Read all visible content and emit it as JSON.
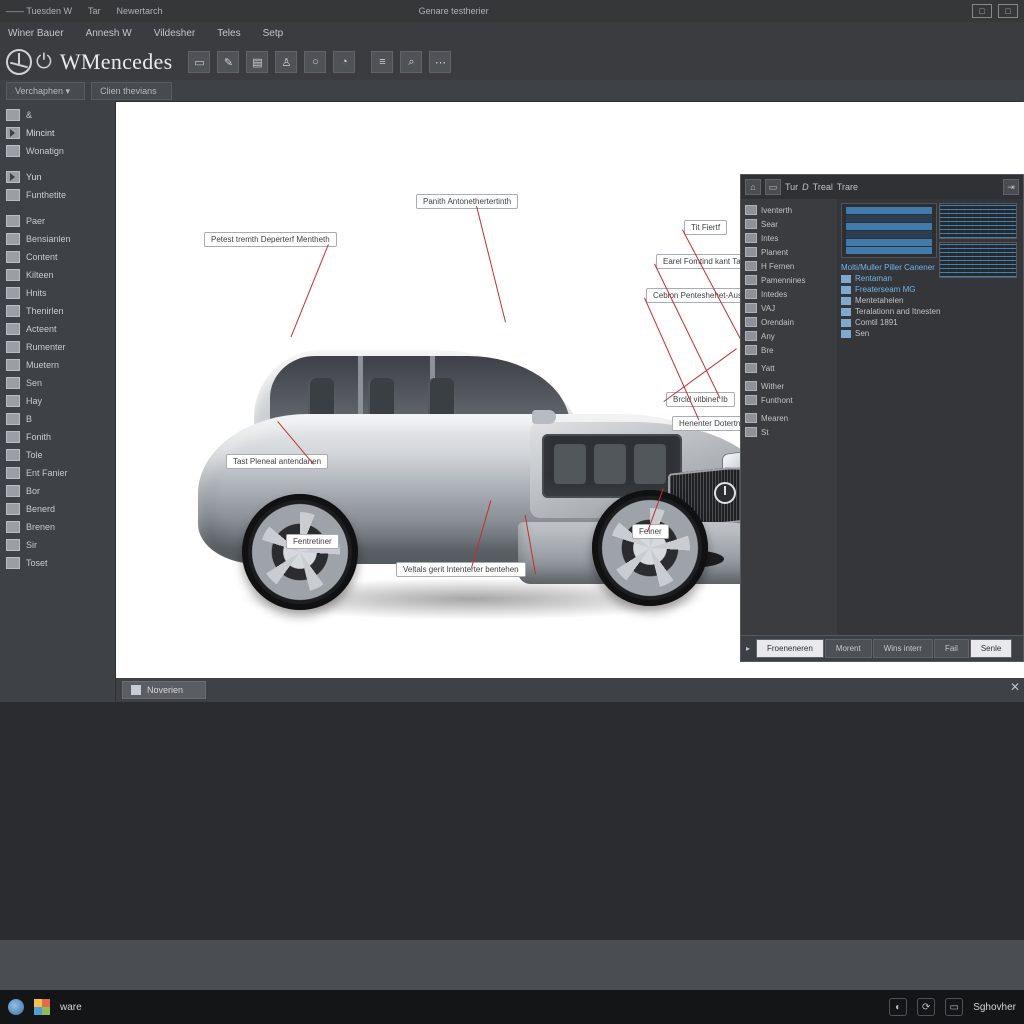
{
  "titlebar": {
    "items": [
      "——  Tuesden W",
      "Tar",
      "Newertarch",
      "Genare testherier"
    ]
  },
  "menubar": [
    "Winer Bauer",
    "Annesh W",
    "Vildesher",
    "Teles",
    "Setp"
  ],
  "brand": "WMencedes",
  "toolbar_icons": [
    "▭",
    "✎",
    "▤",
    "♙",
    "○",
    "◔",
    "≡",
    "⌕",
    "⋯"
  ],
  "doc_tab": "Clien thevians",
  "sidebar_top_label": "Verchaphen",
  "sidebar": [
    {
      "label": "&"
    },
    {
      "label": "Mincint",
      "head": true
    },
    {
      "label": "Wonatign"
    },
    {
      "label": ""
    },
    {
      "label": "Yun",
      "head": true
    },
    {
      "label": "Funthetite"
    },
    {
      "label": ""
    },
    {
      "label": "Paer"
    },
    {
      "label": "Bensianlen"
    },
    {
      "label": "Content"
    },
    {
      "label": "Kilteen"
    },
    {
      "label": "Hnits"
    },
    {
      "label": "Thenirlen"
    },
    {
      "label": "Acteent"
    },
    {
      "label": "Rumenter"
    },
    {
      "label": "Muetern"
    },
    {
      "label": "Sen"
    },
    {
      "label": "Hay"
    },
    {
      "label": "B"
    },
    {
      "label": "Fonith"
    },
    {
      "label": "Tole"
    },
    {
      "label": "Ent Fanier"
    },
    {
      "label": "Bor"
    },
    {
      "label": "Benerd"
    },
    {
      "label": "Brenen"
    },
    {
      "label": "Sir"
    },
    {
      "label": "Toset"
    }
  ],
  "callouts": {
    "c1": "Panith Antonethertertinth",
    "c2": "Petest tremth Deperterf Mentheth",
    "c3": "Tit Fiertf",
    "c4": "Earel Fomtind kant Tant",
    "c5": "Cebion Penteshehet-Ausen",
    "c6": "Brcld vitbinet    Ib",
    "c7": "Henenter  Dotertnen Deberter iten",
    "c8": "Tast Pleneal antendanen",
    "c9": "Fentretiner",
    "c10": "Veltals gerit Intenterter bentehen",
    "c11": "Feiner"
  },
  "canvas_tab": "Noverien",
  "inspector": {
    "tabs": [
      "⌂",
      "▭",
      "Tur",
      "D",
      "Treal",
      "Trare"
    ],
    "left": [
      "Iventerth",
      "Sear",
      "Intes",
      "Planent",
      "H Fernen",
      "Pamennines",
      "Intedes",
      "VAJ",
      "Orendain",
      "Any",
      "Bre",
      "",
      "Yatt",
      "",
      "Wither",
      "Funthont",
      "",
      "Mearen",
      "St"
    ],
    "right_header": "Molti/Muller Piller Canener",
    "right_rows": [
      "Rentaman",
      "Freaterseam MG",
      "Mentetahelen",
      "Teralationn and Itnesten",
      "Comtil 1891",
      "Sen"
    ],
    "bottom": [
      "Froeneneren",
      "Morent",
      "Wins interr",
      "Fail",
      "Senle"
    ]
  },
  "taskbar": {
    "app": "ware",
    "clock": "Sghovher"
  }
}
